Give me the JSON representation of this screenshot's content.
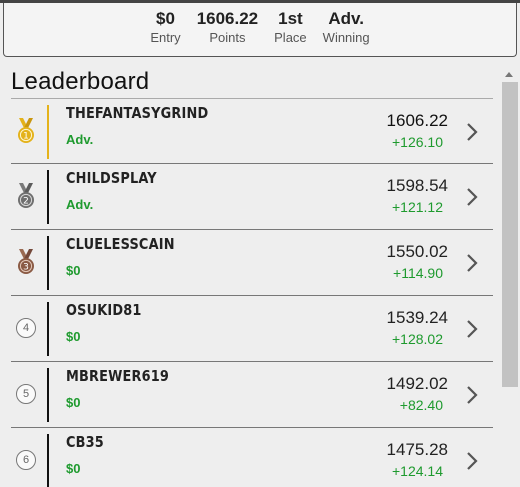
{
  "summary": {
    "stats": [
      {
        "value": "$0",
        "label": "Entry"
      },
      {
        "value": "1606.22",
        "label": "Points"
      },
      {
        "value": "1st",
        "label": "Place"
      },
      {
        "value": "Adv.",
        "label": "Winning"
      }
    ]
  },
  "leaderboard": {
    "title": "Leaderboard",
    "rows": [
      {
        "rank": "1",
        "badge": "gold-medal-icon",
        "name": "THEFANTASYGRIND",
        "winning": "Adv.",
        "points": "1606.22",
        "delta": "+126.10"
      },
      {
        "rank": "2",
        "badge": "silver-medal-icon",
        "name": "CHILDSPLAY",
        "winning": "Adv.",
        "points": "1598.54",
        "delta": "+121.12"
      },
      {
        "rank": "3",
        "badge": "bronze-medal-icon",
        "name": "CLUELESSCAIN",
        "winning": "$0",
        "points": "1550.02",
        "delta": "+114.90"
      },
      {
        "rank": "4",
        "badge": "rank-circle",
        "name": "OSUKID81",
        "winning": "$0",
        "points": "1539.24",
        "delta": "+128.02"
      },
      {
        "rank": "5",
        "badge": "rank-circle",
        "name": "MBREWER619",
        "winning": "$0",
        "points": "1492.02",
        "delta": "+82.40"
      },
      {
        "rank": "6",
        "badge": "rank-circle",
        "name": "CB35",
        "winning": "$0",
        "points": "1475.28",
        "delta": "+124.14"
      }
    ]
  },
  "colors": {
    "gold": "#e4b21a",
    "silver": "#6f6f6f",
    "bronze": "#8a5a44",
    "positive": "#1e9a2e"
  }
}
